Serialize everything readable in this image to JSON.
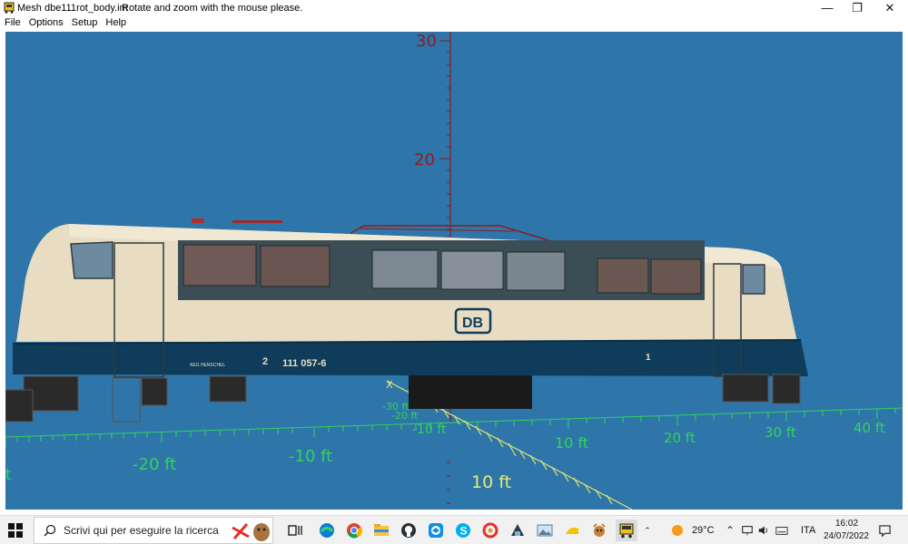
{
  "window": {
    "title": "Mesh dbe111rot_body.im",
    "hint": "Rotate and zoom with the mouse please."
  },
  "menu": [
    "File",
    "Options",
    "Setup",
    "Help"
  ],
  "viewport": {
    "background_color": "#2e75a9",
    "vertical_axis_labels": [
      "30",
      "20"
    ],
    "ground_axis_labels_x": [
      "-20 ft",
      "-10 ft",
      "10 ft",
      "20 ft",
      "30 ft",
      "40 ft",
      "t"
    ],
    "ground_axis_labels_near": [
      "-30 ft",
      "-20 ft",
      "-10 ft"
    ],
    "depth_axis_label": "10 ft",
    "axis_letter": "X",
    "locomotive": {
      "logo": "DB",
      "number": "111 057-6",
      "cab_left": "2",
      "cab_right": "1",
      "maker": "AEG HENSCHEL"
    }
  },
  "taskbar": {
    "search_placeholder": "Scrivi qui per eseguire la ricerca",
    "weather": "29°C",
    "language": "ITA",
    "time": "16:02",
    "date": "24/07/2022",
    "apps": [
      "task-view-icon",
      "edge-icon",
      "chrome-icon",
      "file-explorer-icon",
      "github-icon",
      "teamviewer-icon",
      "skype-icon",
      "app-red-icon",
      "app-dark-icon",
      "photos-icon",
      "app-yellow-icon",
      "app-brown-icon",
      "app-locomotive-icon"
    ]
  }
}
